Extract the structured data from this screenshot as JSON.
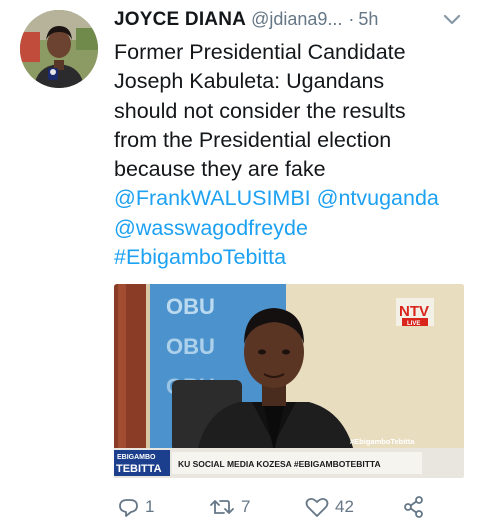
{
  "tweet": {
    "author_name": "JOYCE DIANA",
    "handle": "@jdiana9...",
    "separator": "·",
    "time": "5h",
    "text_lines": [
      "Former Presidential Candidate",
      "Joseph Kabuleta: Ugandans",
      "should not consider the results",
      "from the Presidential election",
      "because they are fake"
    ],
    "mentions": [
      "@FrankWALUSIMBI",
      "@ntvuganda",
      "@wasswagodfreyde"
    ],
    "hashtag": "#EbigamboTebitta"
  },
  "media": {
    "channel_logo": "NTV",
    "channel_live": "LIVE",
    "backdrop_text": "OBU",
    "screen_hashtag": "#EbigamboTebitta",
    "ticker_label_top": "EBIGAMBO",
    "ticker_label_bottom": "TEBITTA",
    "ticker_text": "KU SOCIAL MEDIA KOZESA #EBIGAMBOTEBITTA"
  },
  "actions": {
    "reply_count": "1",
    "retweet_count": "7",
    "like_count": "42"
  },
  "icons": [
    "avatar",
    "chevron-down-icon",
    "reply-icon",
    "retweet-icon",
    "like-icon",
    "share-icon"
  ],
  "colors": {
    "link": "#1da1f2",
    "meta": "#657786",
    "text": "#14171a"
  }
}
